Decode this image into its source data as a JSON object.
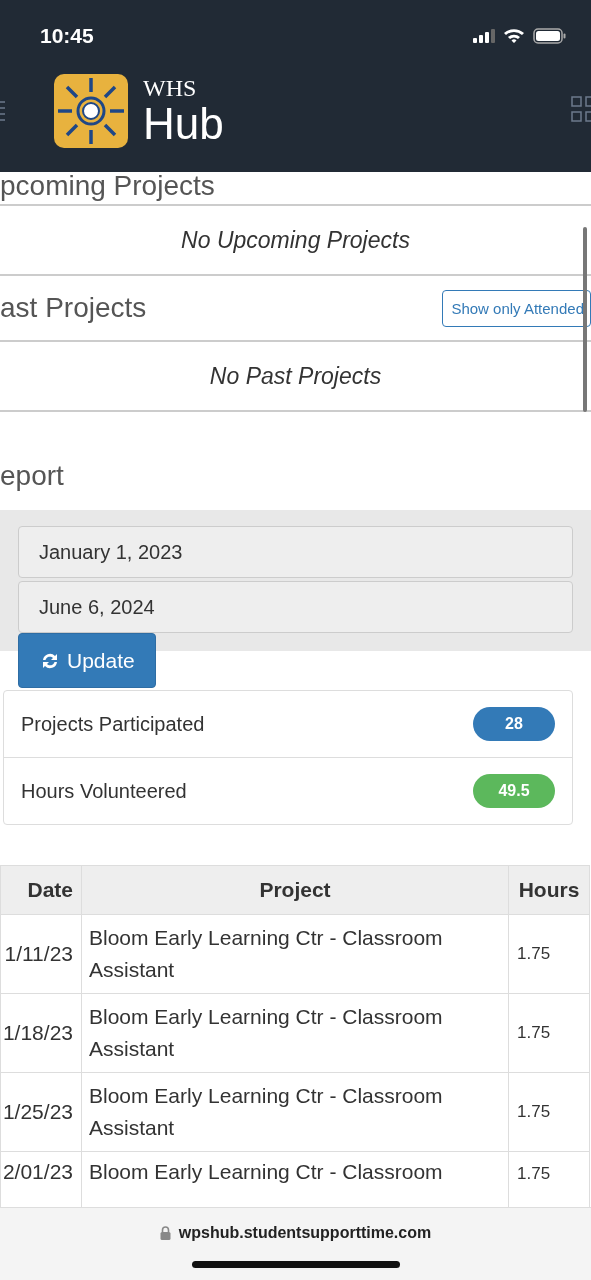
{
  "status_bar": {
    "time": "10:45"
  },
  "header": {
    "logo_small": "WHS",
    "logo_large": "Hub"
  },
  "upcoming": {
    "title": "pcoming Projects",
    "empty": "No Upcoming Projects"
  },
  "past": {
    "title": "ast Projects",
    "filter_button": "Show only Attended",
    "empty": "No Past Projects"
  },
  "report": {
    "title": "eport",
    "start_date": "January 1, 2023",
    "end_date": "June 6, 2024",
    "update_button": "Update",
    "stats": [
      {
        "label": "Projects Participated",
        "value": "28",
        "color": "#337ab7"
      },
      {
        "label": "Hours Volunteered",
        "value": "49.5",
        "color": "#5cb85c"
      }
    ]
  },
  "table": {
    "columns": [
      "Date",
      "Project",
      "Hours"
    ],
    "rows": [
      [
        "1/11/23",
        "Bloom Early Learning Ctr - Classroom Assistant",
        "1.75"
      ],
      [
        "1/18/23",
        "Bloom Early Learning Ctr - Classroom Assistant",
        "1.75"
      ],
      [
        "1/25/23",
        "Bloom Early Learning Ctr - Classroom Assistant",
        "1.75"
      ],
      [
        "2/01/23",
        "Bloom Early Learning Ctr - Classroom",
        "1.75"
      ]
    ]
  },
  "browser_bar": {
    "url": "wpshub.studentsupporttime.com"
  }
}
